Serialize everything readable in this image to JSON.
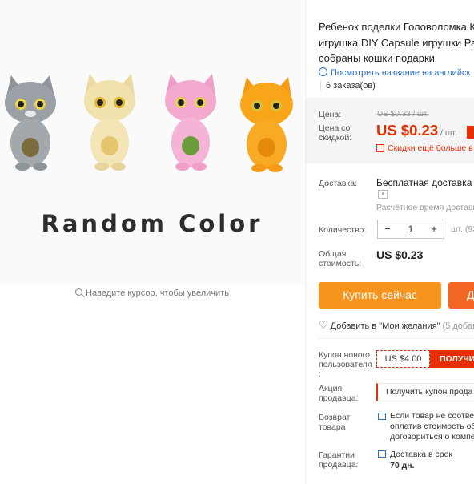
{
  "gallery": {
    "image_text": "Random Color",
    "zoom_hint": "Наведите курсор, чтобы увеличить"
  },
  "product": {
    "title_line1": "Ребенок поделки Головоломка К",
    "title_line2": "игрушка DIY Capsule игрушки Ра",
    "title_line3": "собраны кошки подарки",
    "translate_link": "Посмотреть название на английск",
    "orders": "6 заказа(ов)"
  },
  "price": {
    "price_label": "Цена:",
    "old_price": "US $0.33 / шт.",
    "sale_label_1": "Цена со",
    "sale_label_2": "скидкой:",
    "sale_price": "US $0.23",
    "per_unit": "/ шт.",
    "qr_text": "Скидки ещё больше в",
    "accent_color": "#e62e04"
  },
  "shipping": {
    "label": "Доставка:",
    "value": "Бесплатная доставка в",
    "time": "Расчётное время доставк"
  },
  "quantity": {
    "label": "Количество:",
    "minus": "−",
    "value": "1",
    "plus": "+",
    "unit": "шт. (93"
  },
  "total": {
    "label_1": "Общая",
    "label_2": "стоимость:",
    "value": "US $0.23"
  },
  "actions": {
    "buy_now": "Купить сейчас",
    "add_to_cart": "Д",
    "wishlist": "Добавить в \"Мои желания\"",
    "wishlist_count": "(5 добав"
  },
  "coupons": {
    "new_user_label_1": "Купон нового",
    "new_user_label_2": "пользователя",
    "new_user_label_3": ":",
    "new_user_value": "US $4.00",
    "new_user_button": "ПОЛУЧИ",
    "seller_label_1": "Акция",
    "seller_label_2": "продавца:",
    "seller_value": "Получить купон прода"
  },
  "returns": {
    "label_1": "Возврат",
    "label_2": "товара",
    "line1": "Если товар не соответ",
    "line2": "оплатив стоимость об",
    "line3": "договориться о компе"
  },
  "guarantee": {
    "label_1": "Гарантии",
    "label_2": "продавца:",
    "line1": "Доставка в срок",
    "line2": "70 дн."
  }
}
